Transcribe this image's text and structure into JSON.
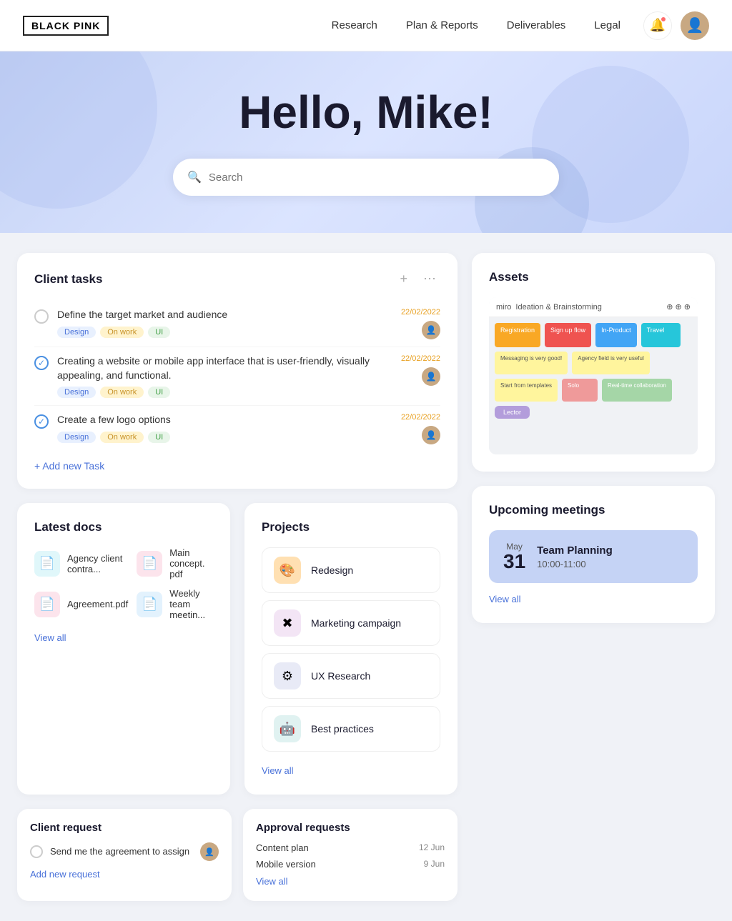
{
  "navbar": {
    "logo": "BLACK PINK",
    "links": [
      {
        "label": "Research",
        "id": "research"
      },
      {
        "label": "Plan & Reports",
        "id": "plan-reports"
      },
      {
        "label": "Deliverables",
        "id": "deliverables"
      },
      {
        "label": "Legal",
        "id": "legal"
      }
    ]
  },
  "hero": {
    "greeting": "Hello, Mike!",
    "search_placeholder": "Search"
  },
  "client_tasks": {
    "title": "Client tasks",
    "add_label": "+ Add new Task",
    "tasks": [
      {
        "text": "Define the target market and audience",
        "done": false,
        "tags": [
          "Design",
          "On work",
          "UI"
        ],
        "date": "22/02/2022"
      },
      {
        "text": "Creating a website or mobile app interface that is user-friendly, visually appealing, and functional.",
        "done": true,
        "tags": [
          "Design",
          "On work",
          "UI"
        ],
        "date": "22/02/2022"
      },
      {
        "text": "Create a few logo options",
        "done": true,
        "tags": [
          "Design",
          "On work",
          "UI"
        ],
        "date": "22/02/2022"
      }
    ]
  },
  "latest_docs": {
    "title": "Latest docs",
    "view_all": "View all",
    "docs": [
      {
        "name": "Agency client contra...",
        "color": "#00bcd4",
        "icon": "📄"
      },
      {
        "name": "Main concept. pdf",
        "color": "#f44336",
        "icon": "📄"
      },
      {
        "name": "Agreement.pdf",
        "color": "#e91e63",
        "icon": "📄"
      },
      {
        "name": "Weekly team meetin...",
        "color": "#2196f3",
        "icon": "📄"
      }
    ]
  },
  "projects": {
    "title": "Projects",
    "view_all": "View all",
    "items": [
      {
        "name": "Redesign",
        "icon": "🎨",
        "color": "#ffe0b2"
      },
      {
        "name": "Marketing campaign",
        "icon": "✖️",
        "color": "#f3e5f5"
      },
      {
        "name": "UX Research",
        "icon": "⚙️",
        "color": "#e8eaf6"
      },
      {
        "name": "Best practices",
        "icon": "🤖",
        "color": "#e0f2f1"
      }
    ]
  },
  "assets": {
    "title": "Assets"
  },
  "upcoming_meetings": {
    "title": "Upcoming meetings",
    "view_all": "View all",
    "meeting": {
      "month": "May",
      "day": "31",
      "title": "Team Planning",
      "time": "10:00-11:00"
    }
  },
  "client_request": {
    "title": "Client request",
    "request_text": "Send me the agreement to assign",
    "add_label": "Add new request"
  },
  "approval_requests": {
    "title": "Approval requests",
    "view_all": "View all",
    "items": [
      {
        "name": "Content plan",
        "date": "12 Jun"
      },
      {
        "name": "Mobile version",
        "date": "9 Jun"
      }
    ]
  }
}
